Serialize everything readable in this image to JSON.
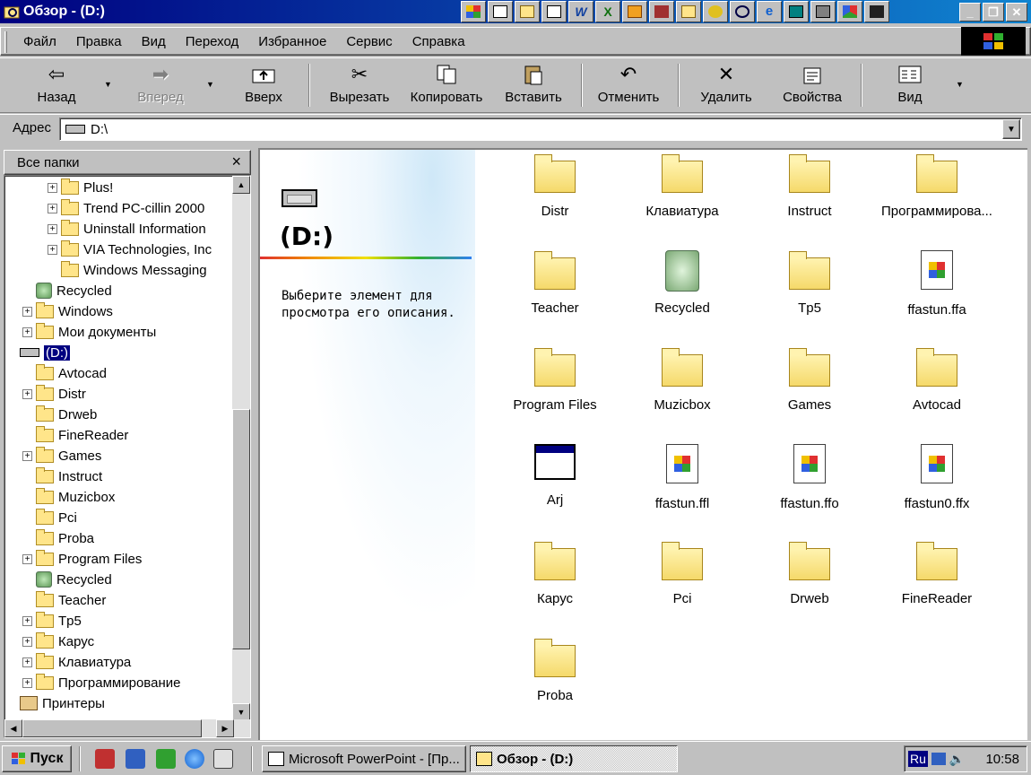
{
  "window": {
    "title": "Обзор -  (D:)"
  },
  "menu": [
    "Файл",
    "Правка",
    "Вид",
    "Переход",
    "Избранное",
    "Сервис",
    "Справка"
  ],
  "toolbar": {
    "back": "Назад",
    "forward": "Вперед",
    "up": "Вверх",
    "cut": "Вырезать",
    "copy": "Копировать",
    "paste": "Вставить",
    "undo": "Отменить",
    "delete": "Удалить",
    "properties": "Свойства",
    "view": "Вид"
  },
  "address": {
    "label": "Адрес",
    "value": "D:\\"
  },
  "folders_pane": {
    "title": "Все папки",
    "close": "×"
  },
  "tree": [
    {
      "label": "Plus!",
      "indent": 2,
      "expand": true,
      "icon": "folder"
    },
    {
      "label": "Trend PC-cillin 2000",
      "indent": 2,
      "expand": true,
      "icon": "folder"
    },
    {
      "label": "Uninstall Information",
      "indent": 2,
      "expand": true,
      "icon": "folder"
    },
    {
      "label": "VIA Technologies, Inc",
      "indent": 2,
      "expand": true,
      "icon": "folder"
    },
    {
      "label": "Windows Messaging",
      "indent": 2,
      "expand": false,
      "icon": "folder"
    },
    {
      "label": "Recycled",
      "indent": 1,
      "expand": false,
      "icon": "recycle"
    },
    {
      "label": "Windows",
      "indent": 1,
      "expand": true,
      "icon": "folder"
    },
    {
      "label": "Мои документы",
      "indent": 1,
      "expand": true,
      "icon": "folder"
    },
    {
      "label": "(D:)",
      "indent": 0,
      "expand": false,
      "icon": "drive",
      "selected": true
    },
    {
      "label": "Avtocad",
      "indent": 1,
      "expand": false,
      "icon": "folder"
    },
    {
      "label": "Distr",
      "indent": 1,
      "expand": true,
      "icon": "folder"
    },
    {
      "label": "Drweb",
      "indent": 1,
      "expand": false,
      "icon": "folder"
    },
    {
      "label": "FineReader",
      "indent": 1,
      "expand": false,
      "icon": "folder"
    },
    {
      "label": "Games",
      "indent": 1,
      "expand": true,
      "icon": "folder"
    },
    {
      "label": "Instruct",
      "indent": 1,
      "expand": false,
      "icon": "folder"
    },
    {
      "label": "Muzicbox",
      "indent": 1,
      "expand": false,
      "icon": "folder"
    },
    {
      "label": "Pci",
      "indent": 1,
      "expand": false,
      "icon": "folder"
    },
    {
      "label": "Proba",
      "indent": 1,
      "expand": false,
      "icon": "folder"
    },
    {
      "label": "Program Files",
      "indent": 1,
      "expand": true,
      "icon": "folder"
    },
    {
      "label": "Recycled",
      "indent": 1,
      "expand": false,
      "icon": "recycle"
    },
    {
      "label": "Teacher",
      "indent": 1,
      "expand": false,
      "icon": "folder"
    },
    {
      "label": "Tp5",
      "indent": 1,
      "expand": true,
      "icon": "folder"
    },
    {
      "label": "Карус",
      "indent": 1,
      "expand": true,
      "icon": "folder"
    },
    {
      "label": "Клавиатура",
      "indent": 1,
      "expand": true,
      "icon": "folder"
    },
    {
      "label": "Программирование",
      "indent": 1,
      "expand": true,
      "icon": "folder"
    },
    {
      "label": "Принтеры",
      "indent": 0,
      "expand": false,
      "icon": "printer"
    }
  ],
  "preview": {
    "title": "(D:)",
    "description": "Выберите элемент для просмотра его описания."
  },
  "items": [
    {
      "name": "Distr",
      "icon": "folder"
    },
    {
      "name": "Клавиатура",
      "icon": "folder"
    },
    {
      "name": "Instruct",
      "icon": "folder"
    },
    {
      "name": "Программирова...",
      "icon": "folder"
    },
    {
      "name": "Teacher",
      "icon": "folder"
    },
    {
      "name": "Recycled",
      "icon": "recycle"
    },
    {
      "name": "Tp5",
      "icon": "folder"
    },
    {
      "name": "ffastun.ffa",
      "icon": "doc"
    },
    {
      "name": "Program Files",
      "icon": "folder"
    },
    {
      "name": "Muzicbox",
      "icon": "folder"
    },
    {
      "name": "Games",
      "icon": "folder"
    },
    {
      "name": "Avtocad",
      "icon": "folder"
    },
    {
      "name": "Arj",
      "icon": "window"
    },
    {
      "name": "ffastun.ffl",
      "icon": "doc"
    },
    {
      "name": "ffastun.ffo",
      "icon": "doc"
    },
    {
      "name": "ffastun0.ffx",
      "icon": "doc"
    },
    {
      "name": "Карус",
      "icon": "folder"
    },
    {
      "name": "Pci",
      "icon": "folder"
    },
    {
      "name": "Drweb",
      "icon": "folder"
    },
    {
      "name": "FineReader",
      "icon": "folder"
    },
    {
      "name": "Proba",
      "icon": "folder"
    }
  ],
  "taskbar": {
    "start": "Пуск",
    "tasks": [
      "Microsoft PowerPoint - [Пр...",
      "Обзор -  (D:)"
    ],
    "lang": "Ru",
    "time": "10:58"
  }
}
